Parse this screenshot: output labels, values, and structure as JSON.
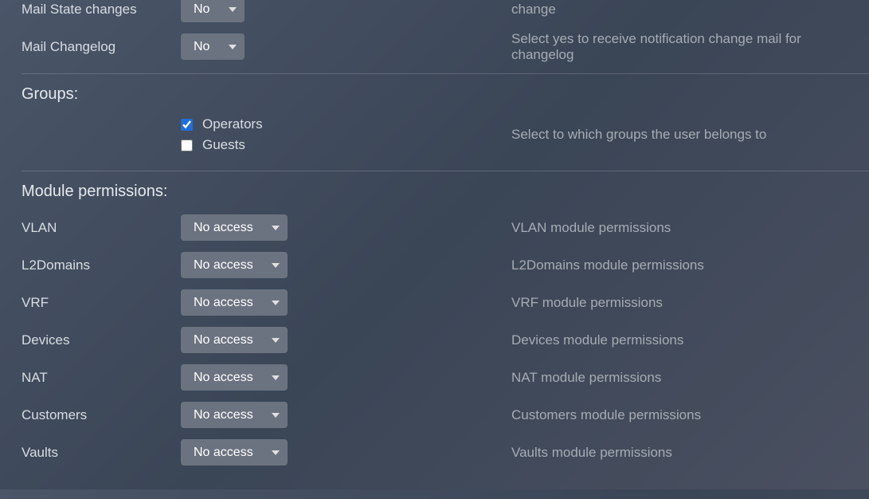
{
  "mail_state": {
    "label": "Mail State changes",
    "value": "No",
    "help": "change"
  },
  "mail_changelog": {
    "label": "Mail Changelog",
    "value": "No",
    "help": "Select yes to receive notification change mail for changelog"
  },
  "sections": {
    "groups": "Groups:",
    "module_perms": "Module permissions:"
  },
  "groups": {
    "help": "Select to which groups the user belongs to",
    "items": [
      {
        "label": "Operators",
        "checked": true
      },
      {
        "label": "Guests",
        "checked": false
      }
    ]
  },
  "select_value_noaccess": "No access",
  "modules": [
    {
      "key": "vlan",
      "label": "VLAN",
      "value": "No access",
      "help": "VLAN module permissions"
    },
    {
      "key": "l2domains",
      "label": "L2Domains",
      "value": "No access",
      "help": "L2Domains module permissions"
    },
    {
      "key": "vrf",
      "label": "VRF",
      "value": "No access",
      "help": "VRF module permissions"
    },
    {
      "key": "devices",
      "label": "Devices",
      "value": "No access",
      "help": "Devices module permissions"
    },
    {
      "key": "nat",
      "label": "NAT",
      "value": "No access",
      "help": "NAT module permissions"
    },
    {
      "key": "customers",
      "label": "Customers",
      "value": "No access",
      "help": "Customers module permissions"
    },
    {
      "key": "vaults",
      "label": "Vaults",
      "value": "No access",
      "help": "Vaults module permissions"
    }
  ]
}
